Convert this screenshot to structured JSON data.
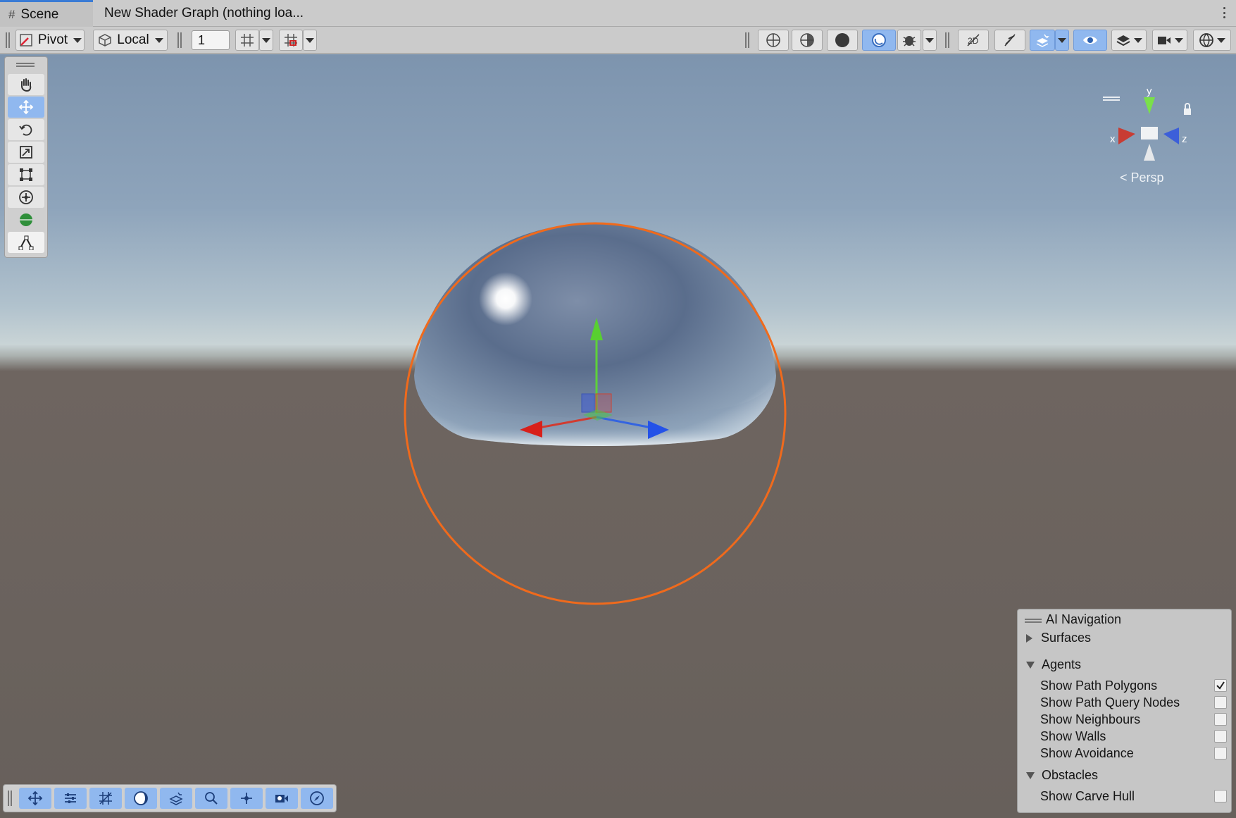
{
  "tabs": {
    "scene_label": "Scene",
    "scene_icon": "hash-icon",
    "shader_label": "New Shader Graph (nothing loa..."
  },
  "toolbar": {
    "pivot_label": "Pivot",
    "local_label": "Local",
    "grid_snap_value": "1",
    "active_draw_mode": "unlit-circle-icon"
  },
  "tools": {
    "items": [
      "hand-icon",
      "move-icon",
      "rotate-icon",
      "scale-icon",
      "rect-icon",
      "transform-icon",
      "sphere-custom-icon",
      "path-tool-icon"
    ],
    "active": "move-icon"
  },
  "gizmo": {
    "y_label": "y",
    "x_label": "x",
    "z_label": "z",
    "persp_label": "Persp"
  },
  "ainav": {
    "title": "AI Navigation",
    "surfaces_label": "Surfaces",
    "agents_label": "Agents",
    "agents_rows": [
      {
        "label": "Show Path Polygons",
        "checked": true
      },
      {
        "label": "Show Path Query Nodes",
        "checked": false
      },
      {
        "label": "Show Neighbours",
        "checked": false
      },
      {
        "label": "Show Walls",
        "checked": false
      },
      {
        "label": "Show Avoidance",
        "checked": false
      }
    ],
    "obstacles_label": "Obstacles",
    "obstacles_rows": [
      {
        "label": "Show Carve Hull",
        "checked": false
      }
    ]
  },
  "colors": {
    "accent": "#3a7bd5",
    "selection_outline": "#f06a1c",
    "toggle_on": "#90b8ef"
  }
}
